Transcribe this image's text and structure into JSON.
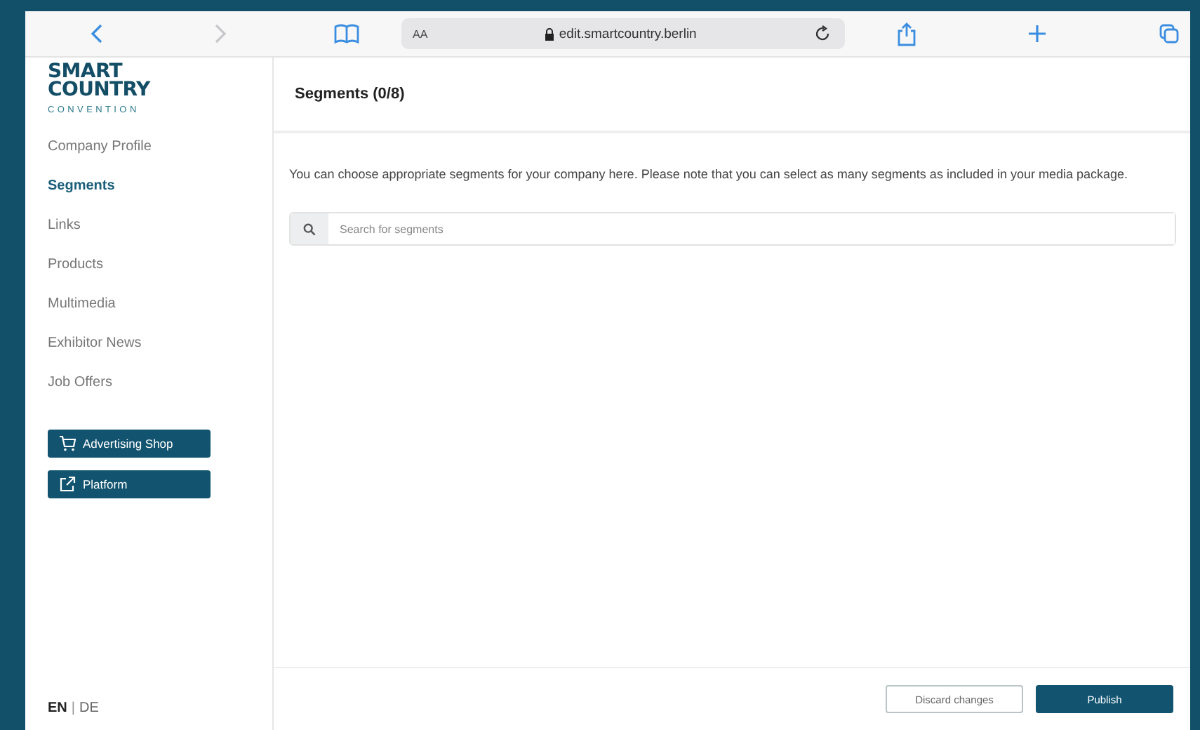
{
  "browser": {
    "text_size": "AA",
    "url": "edit.smartcountry.berlin"
  },
  "logo": {
    "lines": [
      "SMART",
      "COUNTRY"
    ],
    "tagline": "CONVENTION"
  },
  "sidebar": {
    "items": [
      {
        "label": "Company Profile",
        "selected": false
      },
      {
        "label": "Segments",
        "selected": true
      },
      {
        "label": "Links",
        "selected": false
      },
      {
        "label": "Products",
        "selected": false
      },
      {
        "label": "Multimedia",
        "selected": false
      },
      {
        "label": "Exhibitor News",
        "selected": false
      },
      {
        "label": "Job Offers",
        "selected": false
      }
    ],
    "buttons": [
      {
        "kind": "cart",
        "label": "Advertising Shop"
      },
      {
        "kind": "external",
        "label": "Platform"
      }
    ]
  },
  "languages": [
    {
      "label": "EN",
      "selected": true
    },
    {
      "label": "DE",
      "selected": false
    }
  ],
  "language_separator": "|",
  "header": {
    "title": "Segments (0/8)"
  },
  "intro": "You can choose appropriate segments for your company here. Please note that you can select as many segments as included in your media package.",
  "search": {
    "placeholder": "Search for segments"
  },
  "footer": {
    "buttons": [
      {
        "kind": "secondary",
        "label": "Discard changes"
      },
      {
        "kind": "primary",
        "label": "Publish"
      }
    ]
  }
}
